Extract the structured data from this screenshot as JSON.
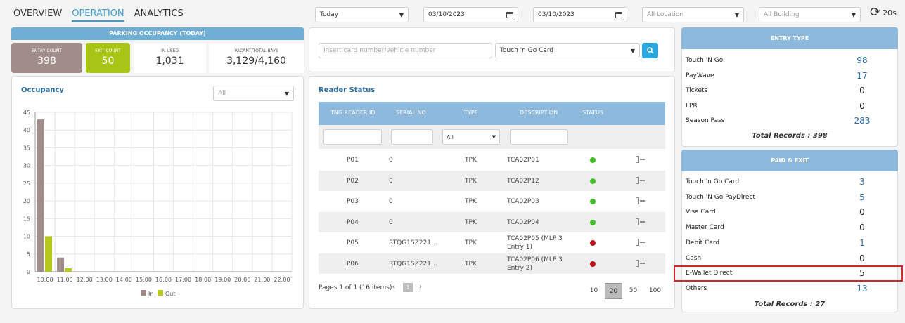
{
  "tabs": {
    "overview": "OVERVIEW",
    "operation": "OPERATION",
    "analytics": "ANALYTICS"
  },
  "filters": {
    "period": "Today",
    "date_from": "03/10/2023",
    "date_to": "03/10/2023",
    "location_placeholder": "All Location",
    "building_placeholder": "All Building",
    "refresh_interval": "20s"
  },
  "parking": {
    "title": "PARKING OCCUPANCY (TODAY)",
    "entry_label": "ENTRY COUNT",
    "entry_value": "398",
    "exit_label": "EXIT COUNT",
    "exit_value": "50",
    "inused_label": "IN USED",
    "inused_value": "1,031",
    "vacant_label": "VACANT/TOTAL BAYS",
    "vacant_value": "3,129/4,160"
  },
  "occupancy": {
    "title": "Occupancy",
    "filter": "All"
  },
  "chart_data": {
    "type": "bar",
    "categories": [
      "10:00",
      "11:00",
      "12:00",
      "13:00",
      "14:00",
      "15:00",
      "16:00",
      "17:00",
      "18:00",
      "19:00",
      "20:00",
      "21:00",
      "22:00"
    ],
    "series": [
      {
        "name": "In",
        "color": "#a08c88",
        "values": [
          43,
          4,
          0,
          0,
          0,
          0,
          0,
          0,
          0,
          0,
          0,
          0,
          0
        ]
      },
      {
        "name": "Out",
        "color": "#b5c91a",
        "values": [
          10,
          1,
          0,
          0,
          0,
          0,
          0,
          0,
          0,
          0,
          0,
          0,
          0
        ]
      }
    ],
    "yticks": [
      0,
      5,
      10,
      15,
      20,
      25,
      30,
      35,
      40,
      45
    ],
    "ylim": [
      0,
      45
    ],
    "grid": true,
    "legend": "bottom"
  },
  "search": {
    "placeholder": "Insert card number/vehicle number",
    "card_type": "Touch 'n Go Card"
  },
  "reader": {
    "title": "Reader Status",
    "columns": [
      "TNG READER ID",
      "SERIAL NO.",
      "TYPE",
      "DESCRIPTION",
      "STATUS"
    ],
    "type_filter": "All",
    "rows": [
      {
        "id": "P01",
        "serial": "0",
        "type": "TPK",
        "desc1": "TCA02P01",
        "desc2": "",
        "status": "green"
      },
      {
        "id": "P02",
        "serial": "0",
        "type": "TPK",
        "desc1": "TCA02P12",
        "desc2": "",
        "status": "green"
      },
      {
        "id": "P03",
        "serial": "0",
        "type": "TPK",
        "desc1": "TCA02P03",
        "desc2": "",
        "status": "green"
      },
      {
        "id": "P04",
        "serial": "0",
        "type": "TPK",
        "desc1": "TCA02P04",
        "desc2": "",
        "status": "green"
      },
      {
        "id": "P05",
        "serial": "RTQG1SZ221...",
        "type": "TPK",
        "desc1": "TCA02P05 (MLP 3",
        "desc2": "Entry 1)",
        "status": "red"
      },
      {
        "id": "P06",
        "serial": "RTQG1SZ221...",
        "type": "TPK",
        "desc1": "TCA02P06 (MLP 3",
        "desc2": "Entry 2)",
        "status": "red"
      }
    ],
    "pager_text": "Pages 1 of 1 (16 items)",
    "current_page": "1",
    "page_sizes": [
      "10",
      "20",
      "50",
      "100"
    ],
    "selected_size": "20"
  },
  "entry_type": {
    "title": "ENTRY TYPE",
    "rows": [
      {
        "name": "Touch 'N Go",
        "value": "98",
        "blue": true
      },
      {
        "name": "PayWave",
        "value": "17",
        "blue": true
      },
      {
        "name": "Tickets",
        "value": "0",
        "blue": false
      },
      {
        "name": "LPR",
        "value": "0",
        "blue": false
      },
      {
        "name": "Season Pass",
        "value": "283",
        "blue": true
      }
    ],
    "total": "Total Records : 398"
  },
  "paid_exit": {
    "title": "PAID & EXIT",
    "rows": [
      {
        "name": "Touch 'n Go Card",
        "value": "3",
        "blue": true
      },
      {
        "name": "Touch 'N Go PayDirect",
        "value": "5",
        "blue": true
      },
      {
        "name": "Visa Card",
        "value": "0",
        "blue": false
      },
      {
        "name": "Master Card",
        "value": "0",
        "blue": false
      },
      {
        "name": "Debit Card",
        "value": "1",
        "blue": true
      },
      {
        "name": "Cash",
        "value": "0",
        "blue": false
      },
      {
        "name": "E-Wallet Direct",
        "value": "5",
        "blue": false
      },
      {
        "name": "Others",
        "value": "13",
        "blue": true
      }
    ],
    "total": "Total Records : 27"
  }
}
